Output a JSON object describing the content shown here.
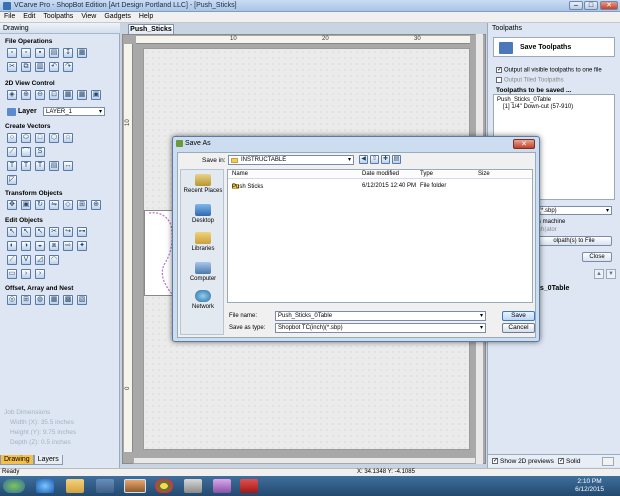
{
  "app": {
    "title": "VCarve Pro - ShopBot Edition [Art Design Portland LLC] - [Push_Sticks]"
  },
  "menu": [
    "File",
    "Edit",
    "Toolpaths",
    "View",
    "Gadgets",
    "Help"
  ],
  "left_panel": {
    "tab": "Drawing",
    "sections": {
      "file_ops": "File Operations",
      "view_control": "2D View Control",
      "create_vectors": "Create Vectors",
      "transform": "Transform Objects",
      "edit_objects": "Edit Objects",
      "offset": "Offset, Array and Nest"
    },
    "layer_label": "Layer",
    "layer_value": "LAYER_1",
    "job": {
      "title": "Job Dimensions",
      "width": "Width  (X): 35.5 inches",
      "height": "Height (Y): 9.75 inches",
      "depth": "Depth  (Z): 0.5 inches"
    },
    "bottom_tabs": [
      "Drawing",
      "Layers"
    ]
  },
  "document": {
    "tab": "Push_Sticks",
    "ruler": {
      "h": [
        "10",
        "20",
        "30"
      ],
      "v": [
        "10",
        "0"
      ]
    }
  },
  "right_panel": {
    "title": "Toolpaths",
    "save_title": "Save Toolpaths",
    "opt1": "Output all visible toolpaths to one file",
    "opt2": "Output Tiled Toolpaths",
    "list_title": "Toolpaths to be saved ...",
    "list": [
      "Push_Sticks_0Table",
      "[1] 1/4\" Down-cut (57-910)"
    ],
    "post": "(*.sbp)",
    "machine": "s machine",
    "tool_changer": "ch(ator",
    "save_btn": "olpath(s) to File",
    "close_btn": "Close",
    "big_label": "ks_0Table",
    "show2d": "Show 2D previews",
    "solid": "Solid"
  },
  "statusbar": {
    "left": "Ready",
    "coords": "X: 34.1348 Y: -4.1085"
  },
  "taskbar": {
    "time": "2:10 PM",
    "date": "6/12/2015"
  },
  "dialog": {
    "title": "Save As",
    "save_in_label": "Save in:",
    "save_in_value": "INSTRUCTABLE",
    "places": [
      "Recent Places",
      "Desktop",
      "Libraries",
      "Computer",
      "Network"
    ],
    "columns": [
      "Name",
      "Date modified",
      "Type",
      "Size"
    ],
    "rows": [
      {
        "name": "Push Sticks",
        "date": "6/12/2015 12:40 PM",
        "type": "File folder",
        "size": ""
      }
    ],
    "file_name_label": "File name:",
    "file_name": "Push_Sticks_0Table",
    "save_type_label": "Save as type:",
    "save_type": "Shopbot TC(inch)(*.sbp)",
    "save_btn": "Save",
    "cancel_btn": "Cancel"
  }
}
